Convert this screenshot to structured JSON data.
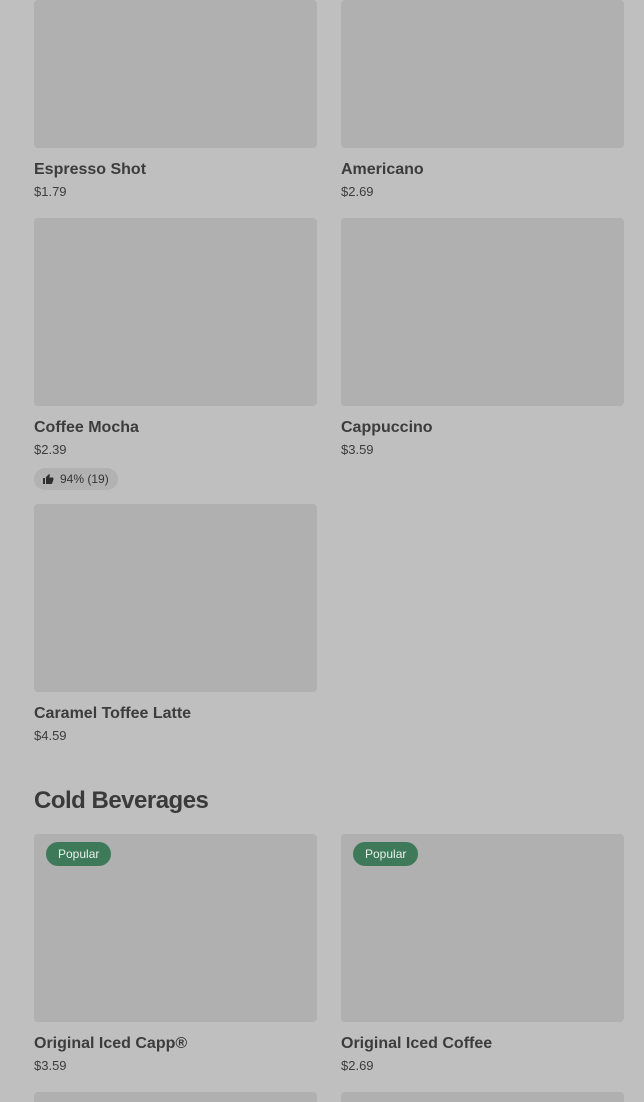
{
  "hot_items": [
    {
      "name": "Espresso Shot",
      "price": "$1.79"
    },
    {
      "name": "Americano",
      "price": "$2.69"
    },
    {
      "name": "Coffee Mocha",
      "price": "$2.39",
      "rating": "94% (19)"
    },
    {
      "name": "Cappuccino",
      "price": "$3.59"
    },
    {
      "name": "Caramel Toffee Latte",
      "price": "$4.59"
    }
  ],
  "cold_section": {
    "title": "Cold Beverages",
    "items": [
      {
        "name": "Original Iced Capp®",
        "price": "$3.59",
        "badge": "Popular"
      },
      {
        "name": "Original Iced Coffee",
        "price": "$2.69",
        "badge": "Popular"
      }
    ]
  },
  "icons": {
    "rating": "thumbs-up-icon"
  },
  "colors": {
    "badge_bg": "#3e7a5a",
    "placeholder": "#b0b0b0",
    "background": "#bfbfbf"
  }
}
